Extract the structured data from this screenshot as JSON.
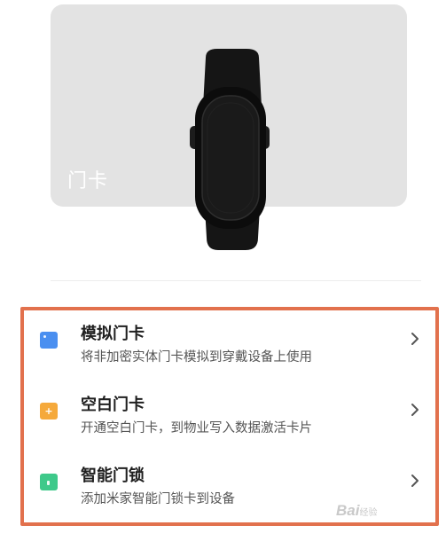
{
  "card": {
    "label": "门卡"
  },
  "menu": {
    "items": [
      {
        "title": "模拟门卡",
        "subtitle": "将非加密实体门卡模拟到穿戴设备上使用",
        "icon": "card-icon",
        "icon_color": "#4a8ff0"
      },
      {
        "title": "空白门卡",
        "subtitle": "开通空白门卡，到物业写入数据激活卡片",
        "icon": "blank-card-icon",
        "icon_color": "#f5a93b"
      },
      {
        "title": "智能门锁",
        "subtitle": "添加米家智能门锁卡到设备",
        "icon": "smart-lock-icon",
        "icon_color": "#3ec98a"
      }
    ]
  },
  "highlight_color": "#e2714d",
  "watermark": {
    "text": "Bai",
    "sub": "经验"
  }
}
